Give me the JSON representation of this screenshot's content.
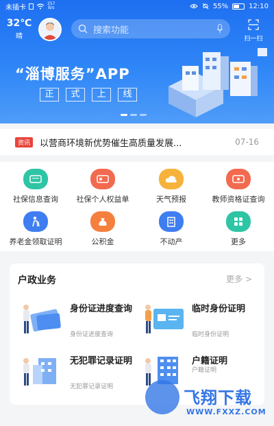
{
  "status": {
    "carrier": "未插卡",
    "speed_value": "257",
    "speed_unit": "B/s",
    "battery": "55%",
    "time": "12:10"
  },
  "weather": {
    "temp": "32℃",
    "condition": "晴"
  },
  "search": {
    "placeholder": "搜索功能"
  },
  "scan": {
    "label": "扫一扫"
  },
  "banner": {
    "title": "“淄博服务”APP",
    "sub": [
      "正",
      "式",
      "上",
      "线"
    ]
  },
  "news": {
    "tag": "资讯",
    "title": "以营商环境新优势催生高质量发展...",
    "date": "07-16"
  },
  "services": [
    {
      "label": "社保信息查询",
      "color": "#2ec5a5"
    },
    {
      "label": "社保个人权益单",
      "color": "#f26a4f"
    },
    {
      "label": "天气预报",
      "color": "#f7b23b"
    },
    {
      "label": "教师资格证查询",
      "color": "#f26a4f"
    },
    {
      "label": "养老金领取证明",
      "color": "#3f7ef0"
    },
    {
      "label": "公积金",
      "color": "#f5803e"
    },
    {
      "label": "不动产",
      "color": "#3f7ef0"
    },
    {
      "label": "更多",
      "color": "#2ec5a5"
    }
  ],
  "household": {
    "title": "户政业务",
    "more": "更多 >",
    "items": [
      {
        "title": "身份证进度查询",
        "sub": "身份证进度查询"
      },
      {
        "title": "临时身份证明",
        "sub": "临时身份证明"
      },
      {
        "title": "无犯罪记录证明",
        "sub": "无犯罪记录证明"
      },
      {
        "title": "户籍证明",
        "sub": "户籍证明"
      }
    ]
  },
  "watermark": {
    "name": "飞翔下载",
    "url": "WWW.FXXZ.COM"
  }
}
